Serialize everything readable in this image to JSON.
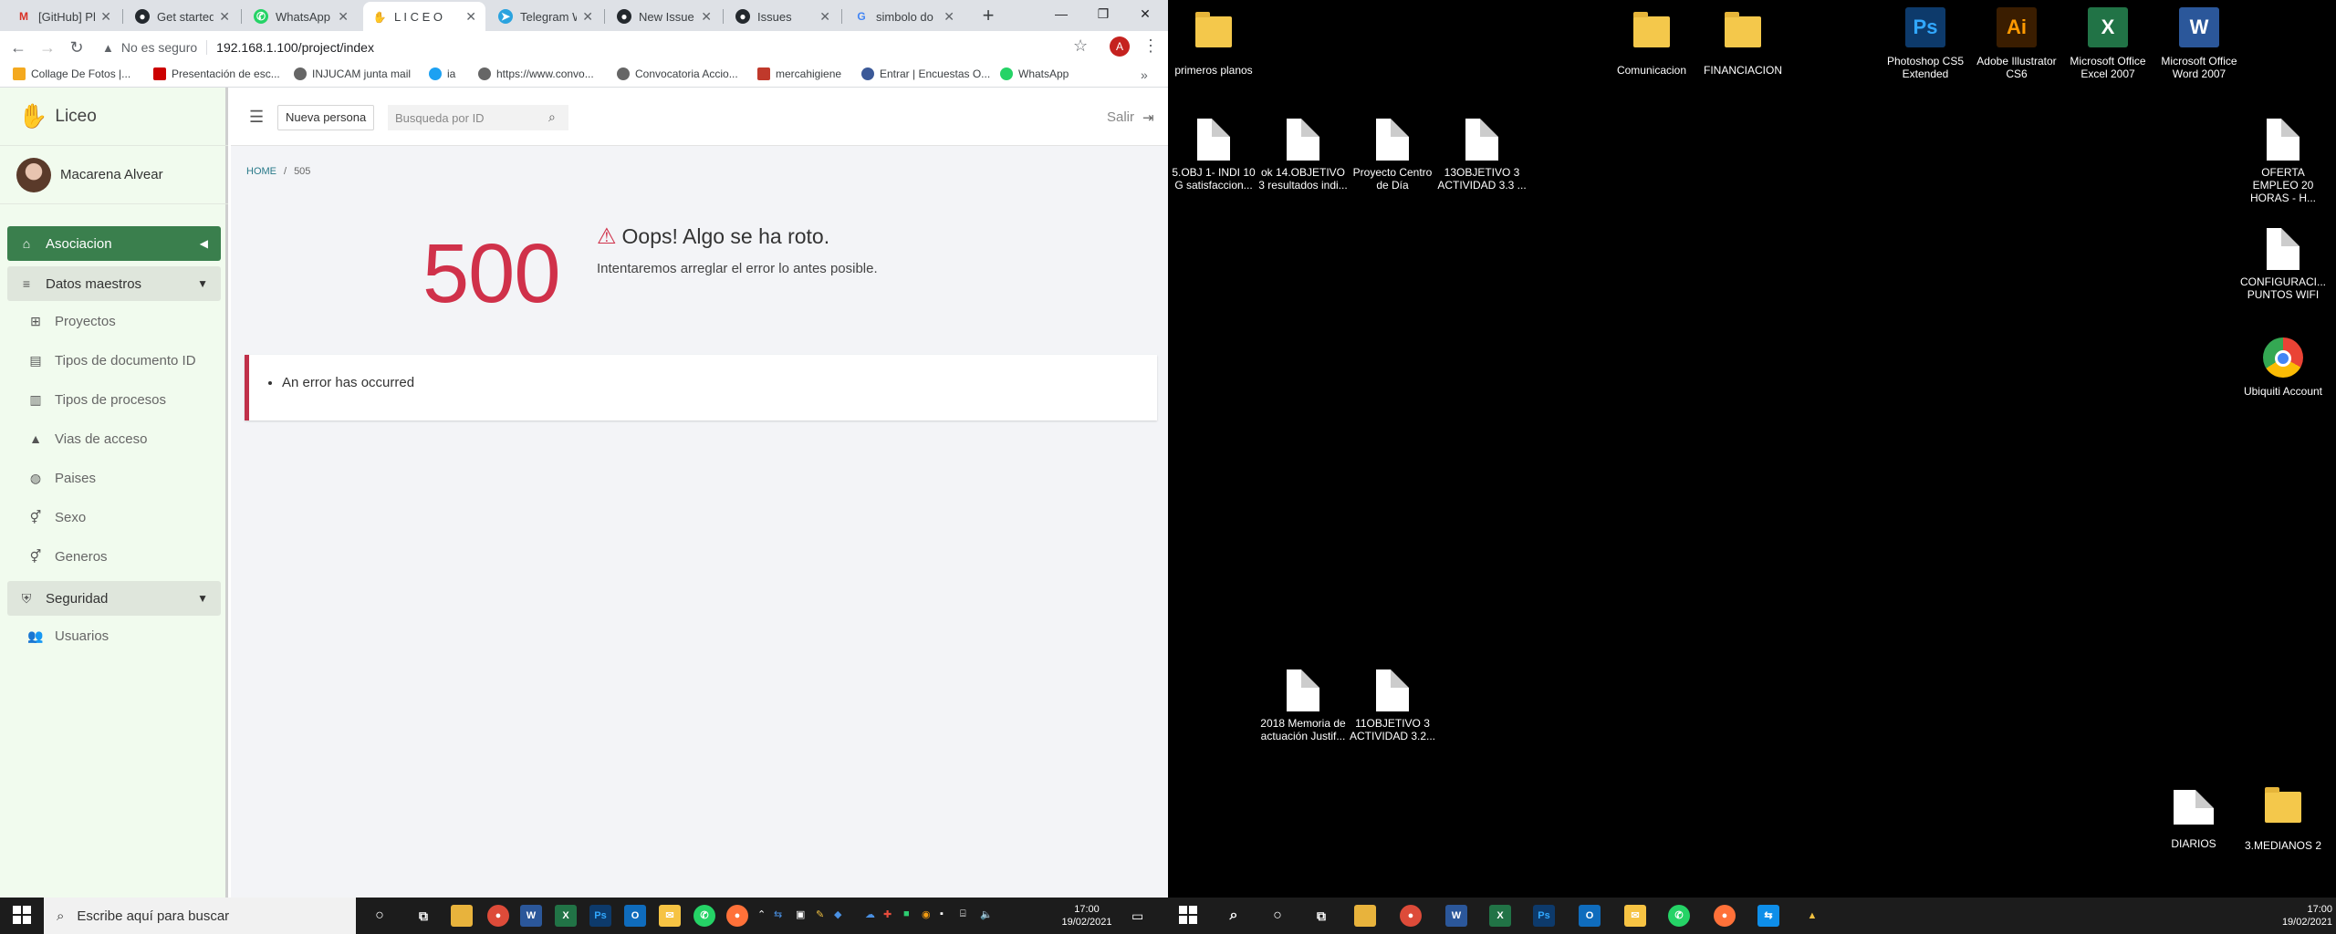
{
  "browser": {
    "tabs": [
      {
        "title": "[GitHub] Ple",
        "icon": "gmail-icon"
      },
      {
        "title": "Get started",
        "icon": "github-icon"
      },
      {
        "title": "WhatsApp",
        "icon": "whatsapp-icon"
      },
      {
        "title": "L I C E O",
        "icon": "liceo-icon"
      },
      {
        "title": "Telegram W",
        "icon": "telegram-icon"
      },
      {
        "title": "New Issue",
        "icon": "github-icon"
      },
      {
        "title": "Issues",
        "icon": "github-icon"
      },
      {
        "title": "simbolo do",
        "icon": "google-icon"
      }
    ],
    "address": {
      "security": "No es seguro",
      "url": "192.168.1.100/project/index"
    },
    "profile_initial": "A",
    "bookmarks": [
      "Collage De Fotos |...",
      "Presentación de esc...",
      "INJUCAM junta mail",
      "ia",
      "https://www.convo...",
      "Convocatoria Accio...",
      "mercahigiene",
      "Entrar | Encuestas O...",
      "WhatsApp"
    ]
  },
  "app": {
    "name": "Liceo",
    "user": "Macarena Alvear",
    "menu": {
      "active": "Asociacion",
      "datos_maestros": "Datos maestros",
      "items": [
        "Proyectos",
        "Tipos de documento ID",
        "Tipos de procesos",
        "Vias de acceso",
        "Paises",
        "Sexo",
        "Generos"
      ],
      "seguridad": "Seguridad",
      "usuarios": "Usuarios"
    },
    "topbar": {
      "new_button": "Nueva persona",
      "search_placeholder": "Busqueda por ID",
      "logout": "Salir"
    },
    "breadcrumb": {
      "home": "HOME",
      "sep": "/",
      "current": "505"
    },
    "error": {
      "code": "500",
      "title": "Oops! Algo se ha roto.",
      "subtitle": "Intentaremos arreglar el error lo antes posible.",
      "message": "An error has occurred"
    }
  },
  "taskbar_left": {
    "search_placeholder": "Escribe aquí para buscar",
    "time": "17:00",
    "date": "19/02/2021"
  },
  "desktop": {
    "icons": [
      {
        "label": "primeros planos",
        "type": "folder"
      },
      {
        "label": "Comunicacion",
        "type": "folder"
      },
      {
        "label": "FINANCIACION",
        "type": "folder"
      },
      {
        "label": "Photoshop CS5 Extended",
        "type": "ps"
      },
      {
        "label": "Adobe Illustrator CS6",
        "type": "ai"
      },
      {
        "label": "Microsoft Office Excel 2007",
        "type": "xl"
      },
      {
        "label": "Microsoft Office Word 2007",
        "type": "wd"
      },
      {
        "label": "5.OBJ 1- INDI 10 G satisfaccion...",
        "type": "doc"
      },
      {
        "label": "ok 14.OBJETIVO 3 resultados indi...",
        "type": "doc"
      },
      {
        "label": "Proyecto Centro de Día",
        "type": "doc"
      },
      {
        "label": "13OBJETIVO 3 ACTIVIDAD 3.3 ...",
        "type": "doc"
      },
      {
        "label": "OFERTA EMPLEO 20 HORAS - H...",
        "type": "doc"
      },
      {
        "label": "CONFIGURACI... PUNTOS WIFI",
        "type": "doc"
      },
      {
        "label": "Ubiquiti Account",
        "type": "chrome"
      },
      {
        "label": "2018 Memoria de actuación Justif...",
        "type": "doc"
      },
      {
        "label": "11OBJETIVO 3 ACTIVIDAD 3.2...",
        "type": "doc"
      },
      {
        "label": "DIARIOS",
        "type": "doc"
      },
      {
        "label": "3.MEDIANOS 2",
        "type": "folder"
      }
    ]
  },
  "taskbar_right": {
    "time": "17:00",
    "date": "19/02/2021"
  },
  "colors": {
    "accent": "#3a7f4d",
    "error": "#d0314a",
    "sidebar_bg": "#f1fbee"
  }
}
